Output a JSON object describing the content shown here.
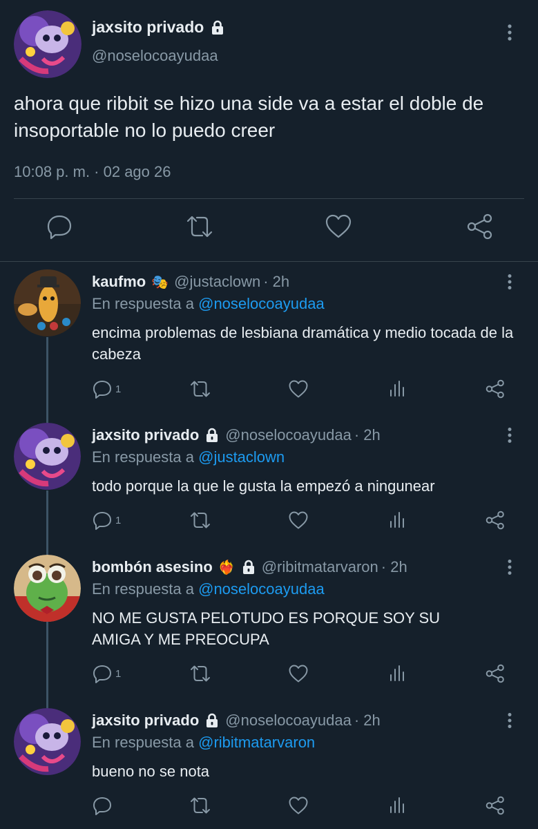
{
  "colors": {
    "background": "#15202b",
    "text": "#e8edf1",
    "muted": "#8899a6",
    "link": "#1d9bf0",
    "divider": "#38444d"
  },
  "main_tweet": {
    "name": "jaxsito privado",
    "handle": "@noselocoayudaa",
    "text": "ahora que ribbit se hizo una side va a estar el doble de insoportable no lo puedo creer",
    "timestamp": "10:08 p. m. · 02 ago 26",
    "icons": [
      "lock-icon",
      "more-vertical-icon",
      "reply-icon",
      "retweet-icon",
      "like-icon",
      "share-icon"
    ]
  },
  "replies": [
    {
      "name": "kaufmo",
      "name_emoji": "🎭",
      "handle": "@justaclown",
      "time": "· 2h",
      "reply_prefix": "En respuesta a",
      "reply_to": "@noselocoayudaa",
      "text": "encima problemas de lesbiana dramática y medio tocada de la cabeza",
      "reply_count": "1"
    },
    {
      "name": "jaxsito privado",
      "handle": "@noselocoayudaa",
      "time": "· 2h",
      "reply_prefix": "En respuesta a",
      "reply_to": "@justaclown",
      "text": "todo porque la que le gusta la empezó a ningunear",
      "reply_count": "1"
    },
    {
      "name": "bombón asesino",
      "name_emoji": "❤️‍🔥",
      "handle": "@ribitmatarvaron",
      "time": "· 2h",
      "reply_prefix": "En respuesta a",
      "reply_to": "@noselocoayudaa",
      "text": "NO ME GUSTA PELOTUDO ES PORQUE SOY SU AMIGA Y ME PREOCUPA",
      "reply_count": "1"
    },
    {
      "name": "jaxsito privado",
      "handle": "@noselocoayudaa",
      "time": "· 2h",
      "reply_prefix": "En respuesta a",
      "reply_to": "@ribitmatarvaron",
      "text": "bueno no se nota",
      "reply_count": ""
    }
  ]
}
